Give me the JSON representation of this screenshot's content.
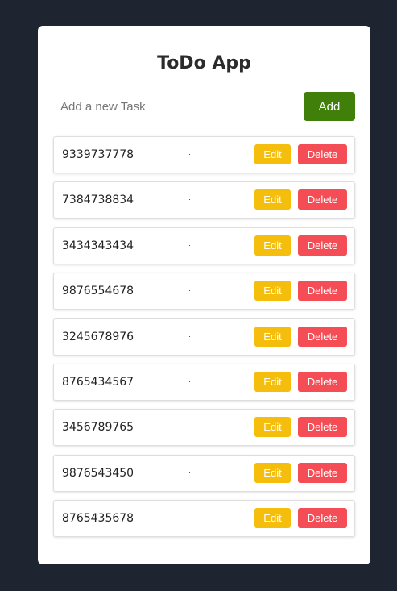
{
  "app": {
    "title": "ToDo App"
  },
  "input": {
    "placeholder": "Add a new Task",
    "value": ""
  },
  "add_button_label": "Add",
  "tasks": [
    {
      "text": "9339737778",
      "edit_label": "Edit",
      "delete_label": "Delete"
    },
    {
      "text": "7384738834",
      "edit_label": "Edit",
      "delete_label": "Delete"
    },
    {
      "text": "3434343434",
      "edit_label": "Edit",
      "delete_label": "Delete"
    },
    {
      "text": "9876554678",
      "edit_label": "Edit",
      "delete_label": "Delete"
    },
    {
      "text": "3245678976",
      "edit_label": "Edit",
      "delete_label": "Delete"
    },
    {
      "text": "8765434567",
      "edit_label": "Edit",
      "delete_label": "Delete"
    },
    {
      "text": "3456789765",
      "edit_label": "Edit",
      "delete_label": "Delete"
    },
    {
      "text": "9876543450",
      "edit_label": "Edit",
      "delete_label": "Delete"
    },
    {
      "text": "8765435678",
      "edit_label": "Edit",
      "delete_label": "Delete"
    }
  ],
  "colors": {
    "background": "#1f2530",
    "card": "#ffffff",
    "add": "#3f7f0a",
    "edit": "#f5bd0c",
    "delete": "#f44d55"
  }
}
